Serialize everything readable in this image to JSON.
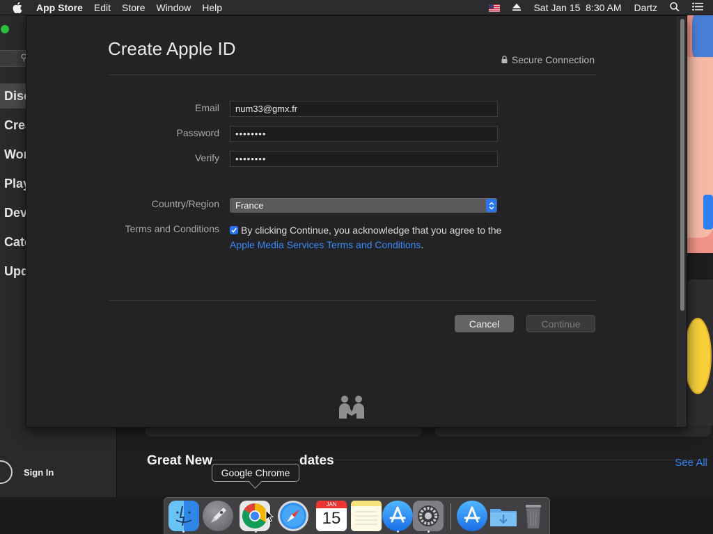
{
  "menubar": {
    "app_name": "App Store",
    "items": [
      "Edit",
      "Store",
      "Window",
      "Help"
    ],
    "date": "Sat Jan 15",
    "time": "8:30 AM",
    "user": "Dartz",
    "icons": [
      "apple-icon",
      "us-flag-icon",
      "eject-icon",
      "spotlight-search-icon",
      "notification-center-icon"
    ]
  },
  "background_window": {
    "sidebar_items": [
      "Disc",
      "Crea",
      "Wor",
      "Play",
      "Dev",
      "Cate",
      "Upd"
    ],
    "active_item_index": 0,
    "sign_in": "Sign In",
    "section_title_left": "Great New",
    "section_title_right": "dates",
    "see_all": "See All"
  },
  "dialog": {
    "title": "Create Apple ID",
    "secure_connection": "Secure Connection",
    "email_label": "Email",
    "email_value": "num33@gmx.fr",
    "password_label": "Password",
    "password_value": "••••••••",
    "verify_label": "Verify",
    "verify_value": "••••••••",
    "country_label": "Country/Region",
    "country_value": "France",
    "terms_label": "Terms and Conditions",
    "terms_checked": true,
    "terms_text_before": "By clicking Continue, you acknowledge that you agree to the ",
    "terms_link": "Apple Media Services Terms and Conditions",
    "terms_text_after": ".",
    "cancel_button": "Cancel",
    "continue_button": "Continue"
  },
  "dock": {
    "tooltip": "Google Chrome",
    "calendar_month": "JAN",
    "calendar_day": "15",
    "apps": [
      "Finder",
      "Launchpad",
      "Google Chrome",
      "Safari",
      "Calendar",
      "Notes",
      "App Store",
      "System Preferences",
      "App Store Downloads",
      "Folder",
      "Trash"
    ]
  },
  "colors": {
    "accent": "#2b75f0",
    "link": "#3b8af5",
    "see_all": "#2f86f6"
  }
}
